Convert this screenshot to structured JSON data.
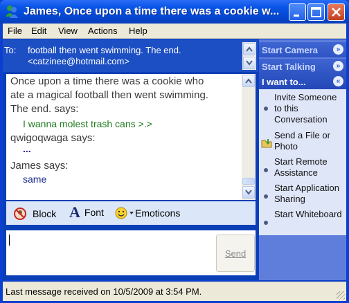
{
  "window": {
    "title": "James, Once upon a time there was a cookie w...",
    "icon": "msn-buddy-icon"
  },
  "menu": [
    "File",
    "Edit",
    "View",
    "Actions",
    "Help"
  ],
  "to": {
    "label": "To:",
    "line1": "football then went swimming. The end.",
    "line2": "<catzinee@hotmail.com>"
  },
  "conversation": [
    {
      "header": [
        "Once upon a time there was a cookie who",
        "ate a magical football then went swimming.",
        "The end. says:"
      ],
      "body": "I wanna molest trash cans >.>",
      "body_color": "#1f7a1f"
    },
    {
      "header": [
        "qwigoqwaga says:"
      ],
      "body": "...",
      "body_color": "#2a1a8a"
    },
    {
      "header": [
        "James says:"
      ],
      "body": "same",
      "body_color": "#1a2a8a"
    }
  ],
  "toolbar": {
    "block_label": "Block",
    "font_label": "Font",
    "emoticons_label": "Emoticons"
  },
  "compose": {
    "send_label": "Send"
  },
  "sidebar": {
    "start_camera": "Start Camera",
    "start_talking": "Start Talking",
    "i_want_to": "I want to...",
    "items": [
      {
        "label": "Invite Someone to this Conversation",
        "icon": "bullet"
      },
      {
        "label": "Send a File or Photo",
        "icon": "folder-icon"
      },
      {
        "label": "Start Remote Assistance",
        "icon": "bullet"
      },
      {
        "label": "Start Application Sharing",
        "icon": "bullet"
      },
      {
        "label": "Start Whiteboard",
        "icon": "bullet"
      }
    ]
  },
  "status": {
    "text": "Last message received on 10/5/2009 at 3:54 PM."
  },
  "colors": {
    "titlebar": "#0a55e6",
    "frame": "#0b3fd1",
    "sidebar": "#5f7edb"
  }
}
